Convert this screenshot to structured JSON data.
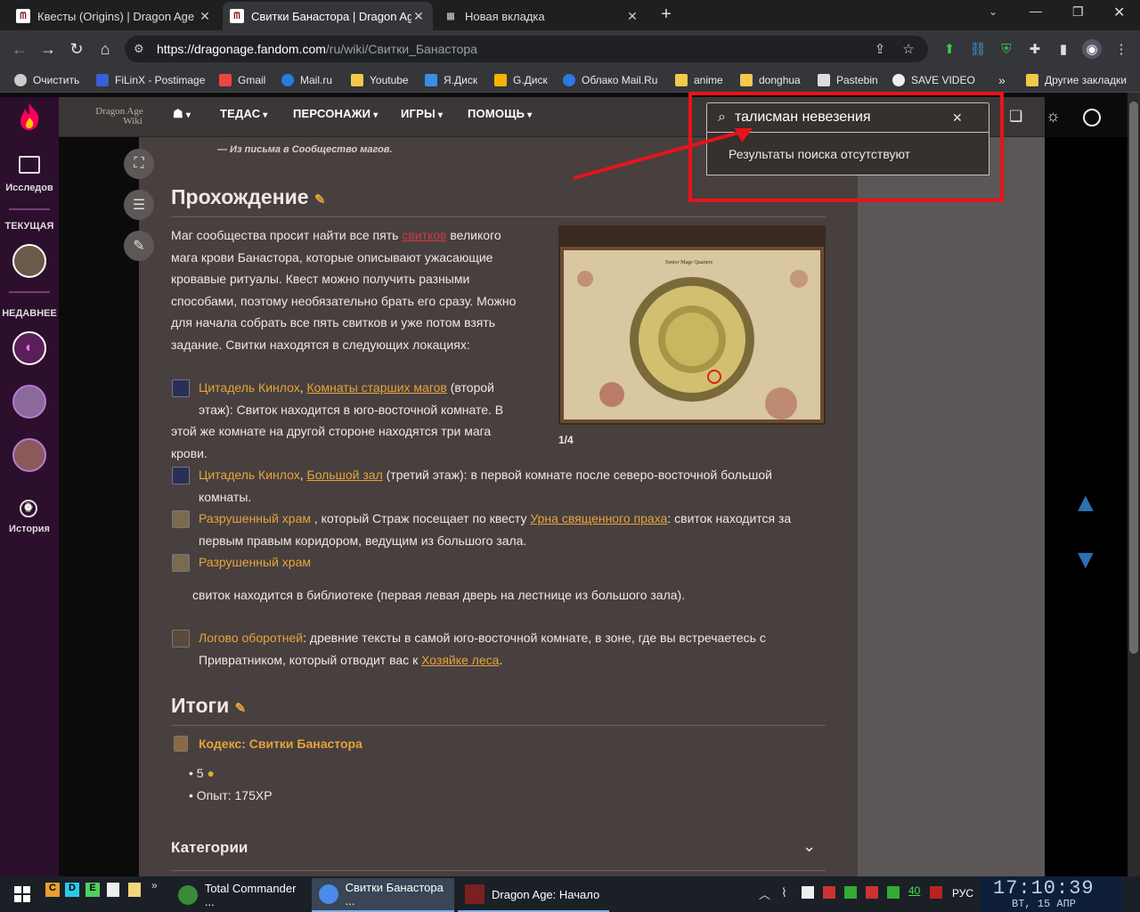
{
  "browser": {
    "tabs": [
      {
        "title": "Квесты (Origins) | Dragon Age W",
        "favicon": "wiki-favicon"
      },
      {
        "title": "Свитки Банастора | Dragon Age",
        "favicon": "wiki-favicon"
      },
      {
        "title": "Новая вкладка",
        "favicon": "newtab-icon"
      }
    ],
    "url_host": "https://dragonage.fandom.com",
    "url_path": "/ru/wiki/Свитки_Банастора",
    "bookmarks": [
      "Очистить",
      "FiLinX - Postimage",
      "Gmail",
      "Mail.ru",
      "Youtube",
      "Я.Диск",
      "G.Диск",
      "Облако Mail.Ru",
      "anime",
      "donghua",
      "Pastebin",
      "SAVE VIDEO"
    ],
    "other_bookmarks": "Другие закладки",
    "chevron": "»"
  },
  "rail": {
    "explore": "Исследов",
    "current": "ТЕКУЩАЯ",
    "recent": "НЕДАВНЕЕ",
    "history": "История"
  },
  "wiki_nav": {
    "logo_line1": "Dragon Age",
    "logo_line2": "Wiki",
    "items": [
      "ТЕДАС",
      "ПЕРСОНАЖИ",
      "ИГРЫ",
      "ПОМОЩЬ"
    ]
  },
  "search": {
    "value": "талисман невезения",
    "no_results": "Результаты поиска отсутствуют"
  },
  "article": {
    "quote_attribution": "— Из письма в Сообщество магов.",
    "walkthrough_heading": "Прохождение",
    "intro_lines": [
      {
        "pre": "Маг сообщества просит найти все пять ",
        "link": "свитков",
        "post": " великого"
      },
      {
        "text": "мага крови Банастора, которые описывают ужасающие"
      },
      {
        "text": "кровавые ритуалы. Квест можно получить разными"
      },
      {
        "text": "способами, поэтому необязательно брать его сразу. Можно"
      },
      {
        "text": "для начала собрать все пять свитков и уже потом взять"
      },
      {
        "text": "задание. Свитки находятся в следующих локациях:"
      }
    ],
    "loc1": {
      "place": "Цитадель Кинлох",
      "room": "Комнаты старших магов",
      "l1tail": " (второй",
      "l2": "этаж): Свиток находится в юго-восточной комнате. В",
      "l3": "этой же комнате на другой стороне находятся три мага",
      "l4": "крови."
    },
    "loc2": {
      "place": "Цитадель Кинлох",
      "room": "Большой зал",
      "l1tail": " (третий этаж): в первой комнате после северо-восточной большой",
      "l2": "комнаты."
    },
    "loc3": {
      "place": "Разрушенный храм",
      "mid": " , который Страж посещает по квесту ",
      "quest": "Урна священного праха",
      "tail": ": свиток находится за",
      "l2": "первым правым коридором, ведущим из большого зала."
    },
    "loc4": {
      "place": "Разрушенный храм",
      "l2": "свиток находится в библиотеке (первая левая дверь на лестнице из большого зала)."
    },
    "loc5": {
      "place": "Логово оборотней",
      "tail": ": древние тексты в самой юго-восточной комнате, в зоне, где вы встречаетесь с",
      "l2pre": "Привратником, который отводит вас к ",
      "l2link": "Хозяйке леса",
      "l2post": "."
    },
    "image_caption": "1/4",
    "image_label": "Senior Mage Quarters",
    "results_heading": "Итоги",
    "codex": "Кодекс: Свитки Банастора",
    "reward_gold": "5",
    "reward_xp": "Опыт: 175XP",
    "categories": "Категории"
  },
  "taskbar": {
    "items": [
      "Total Commander ...",
      "Свитки Банастора ...",
      "Dragon Age: Начало"
    ],
    "quick": [
      "C",
      "D",
      "E"
    ],
    "lang": "РУС",
    "tray_num": "40",
    "time": "17:10:39",
    "date": "ВТ, 15 АПР"
  },
  "colors": {
    "accent_link": "#e8a33a",
    "red_link": "#d1393d",
    "annotation_red": "#e8131b"
  }
}
